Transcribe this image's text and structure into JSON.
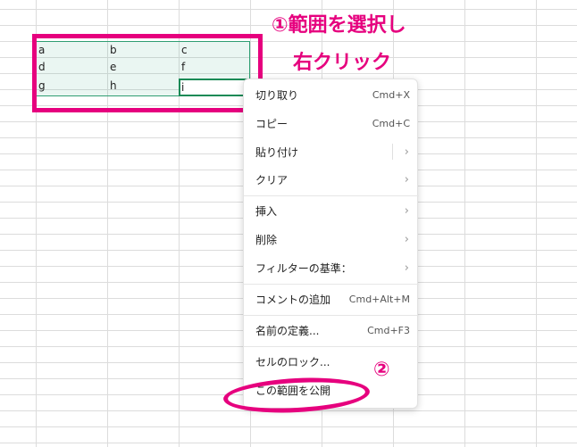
{
  "colors": {
    "annotation": "#e6007e",
    "selection": "#2f9e72",
    "active_cell": "#188a56"
  },
  "cells": [
    {
      "row": 1,
      "col": "A",
      "value": "a"
    },
    {
      "row": 1,
      "col": "B",
      "value": "b"
    },
    {
      "row": 1,
      "col": "C",
      "value": "c"
    },
    {
      "row": 2,
      "col": "A",
      "value": "d"
    },
    {
      "row": 2,
      "col": "B",
      "value": "e"
    },
    {
      "row": 2,
      "col": "C",
      "value": "f"
    },
    {
      "row": 3,
      "col": "A",
      "value": "g"
    },
    {
      "row": 3,
      "col": "B",
      "value": "h"
    },
    {
      "row": 3,
      "col": "C",
      "value": "i"
    }
  ],
  "annotations": {
    "step1_line1": "①範囲を選択し",
    "step1_line2": "右クリック",
    "step2": "②"
  },
  "context_menu": {
    "items": [
      {
        "label": "切り取り",
        "shortcut": "Cmd+X",
        "icon": ""
      },
      {
        "label": "コピー",
        "shortcut": "Cmd+C",
        "icon": ""
      },
      {
        "label": "貼り付け",
        "shortcut": "",
        "icon": "chevron-right-icon"
      },
      {
        "label": "クリア",
        "shortcut": "",
        "icon": "chevron-right-icon"
      },
      {
        "label": "挿入",
        "shortcut": "",
        "icon": "chevron-right-icon"
      },
      {
        "label": "削除",
        "shortcut": "",
        "icon": "chevron-right-icon"
      },
      {
        "label": "フィルターの基準：",
        "shortcut": "",
        "icon": "chevron-right-icon"
      },
      {
        "label": "コメントの追加",
        "shortcut": "Cmd+Alt+M",
        "icon": ""
      },
      {
        "label": "名前の定義...",
        "shortcut": "Cmd+F3",
        "icon": ""
      },
      {
        "label": "セルのロック...",
        "shortcut": "",
        "icon": ""
      },
      {
        "label": "この範囲を公開",
        "shortcut": "",
        "icon": ""
      }
    ]
  }
}
